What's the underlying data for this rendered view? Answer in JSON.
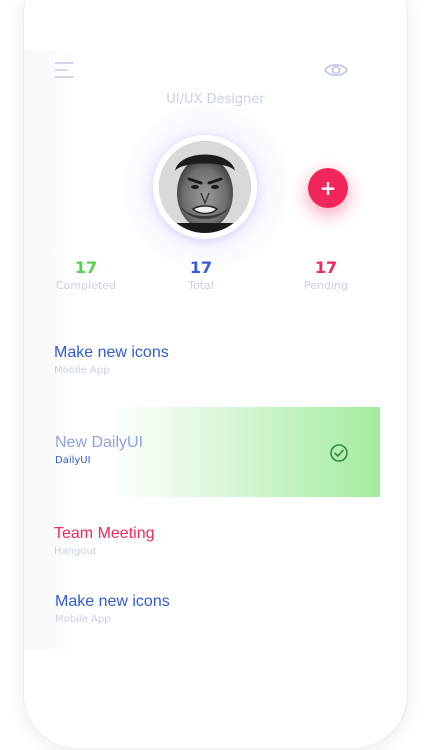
{
  "header": {
    "role": "UI/UX Designer",
    "menu_icon": "hamburger-menu-icon",
    "visibility_icon": "eye-icon"
  },
  "profile": {
    "avatar": "user-avatar",
    "add_button_label": "+"
  },
  "stats": [
    {
      "value": "17",
      "label": "Completed",
      "color": "#53d04f"
    },
    {
      "value": "17",
      "label": "Total",
      "color": "#3b5bdb"
    },
    {
      "value": "17",
      "label": "Pending",
      "color": "#f2265a"
    }
  ],
  "tasks": [
    {
      "title": "Make new icons",
      "subtitle": "Mobile App",
      "title_color": "#2f5bd6",
      "subtitle_color": "#c9d0e6"
    },
    {
      "title": "New DailyUI",
      "subtitle": "DailyUI",
      "title_color": "#8ea2df",
      "subtitle_color": "#2f5bd6",
      "done": true,
      "status_icon": "check-circle-icon"
    },
    {
      "title": "Team Meeting",
      "subtitle": "Hangout",
      "title_color": "#f2265a",
      "subtitle_color": "#c9d0e6"
    },
    {
      "title": "Make new icons",
      "subtitle": "Mobile App",
      "title_color": "#2f5bd6",
      "subtitle_color": "#c9d0e6"
    }
  ],
  "colors": {
    "accent_red": "#f2265a",
    "accent_blue": "#2f5bd6",
    "accent_green": "#53d04f",
    "muted": "#c9d0e6"
  }
}
